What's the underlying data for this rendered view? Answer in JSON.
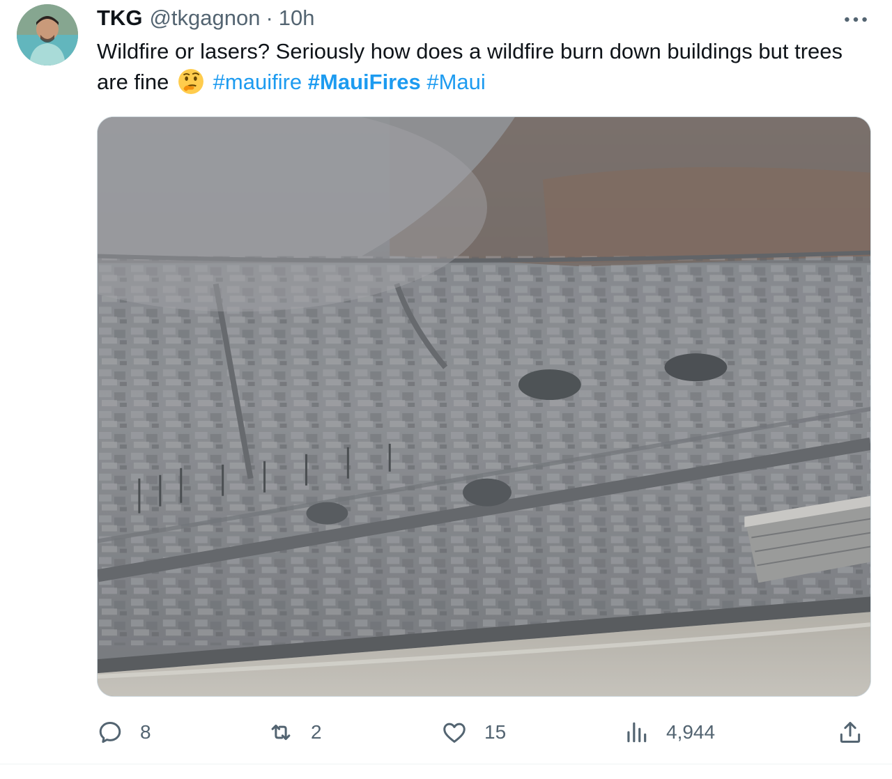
{
  "author": {
    "name": "TKG",
    "handle": "@tkgagnon",
    "separator": "·",
    "time": "10h"
  },
  "tweet": {
    "text_before": "Wildfire or lasers? Seriously how does a wildfire burn down buildings but trees are fine",
    "emoji_icon": "thinking-face-icon",
    "hashtags": [
      "#mauifire",
      "#MauiFires",
      "#Maui"
    ]
  },
  "media": {
    "description_icon": "aerial-photo-burned-town"
  },
  "actions": {
    "replies": "8",
    "retweets": "2",
    "likes": "15",
    "views": "4,944"
  },
  "colors": {
    "link": "#1d9bf0",
    "secondary": "#536471",
    "text": "#0f1419"
  }
}
